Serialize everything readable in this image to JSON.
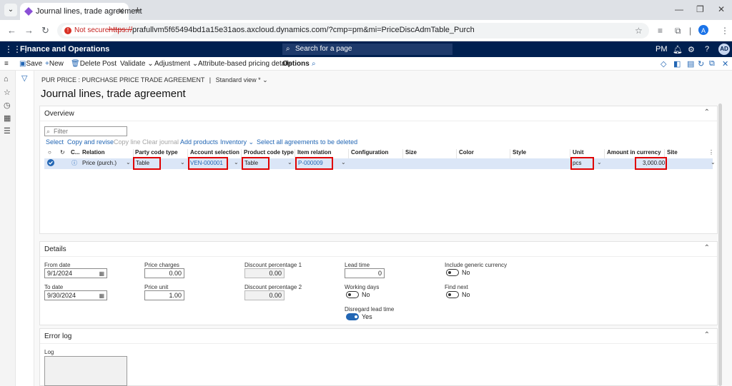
{
  "browser": {
    "tab_title": "Journal lines, trade agreement",
    "not_secure_label": "Not secure",
    "url_protocol": "https://",
    "url_rest": "prafullvm5f65494bd1a15e31aos.axcloud.dynamics.com/?cmp=pm&mi=PriceDiscAdmTable_Purch",
    "profile_initial": "A"
  },
  "navbar": {
    "app_name": "Finance and Operations",
    "search_placeholder": "Search for a page",
    "company": "PM",
    "avatar_initials": "AD"
  },
  "actions": {
    "save": "Save",
    "new": "New",
    "delete": "Delete",
    "post": "Post",
    "validate": "Validate",
    "adjustment": "Adjustment",
    "attribute_pricing": "Attribute-based pricing details",
    "options": "Options"
  },
  "page": {
    "breadcrumb_main": "PUR PRICE : PURCHASE PRICE TRADE AGREEMENT",
    "breadcrumb_sep": "|",
    "view_name": "Standard view *",
    "title": "Journal lines, trade agreement"
  },
  "overview": {
    "header": "Overview",
    "filter_placeholder": "Filter",
    "grid_actions": {
      "select": "Select",
      "copy_revise": "Copy and revise",
      "copy_line": "Copy line",
      "clear_journal": "Clear journal",
      "add_products": "Add products",
      "inventory": "Inventory",
      "select_all_delete": "Select all agreements to be deleted"
    },
    "columns": {
      "c": "C...",
      "relation": "Relation",
      "party_code_type": "Party code type",
      "account_selection": "Account selection",
      "product_code_type": "Product code type",
      "item_relation": "Item relation",
      "configuration": "Configuration",
      "size": "Size",
      "color": "Color",
      "style": "Style",
      "unit": "Unit",
      "amount_in_currency": "Amount in currency",
      "site": "Site"
    },
    "row": {
      "relation": "Price (purch.)",
      "party_code_type": "Table",
      "account_selection": "VEN-000001",
      "product_code_type": "Table",
      "item_relation": "P-000009",
      "unit": "pcs",
      "amount": "3,000.00"
    }
  },
  "details": {
    "header": "Details",
    "from_date_label": "From date",
    "from_date": "9/1/2024",
    "to_date_label": "To date",
    "to_date": "9/30/2024",
    "price_charges_label": "Price charges",
    "price_charges": "0.00",
    "price_unit_label": "Price unit",
    "price_unit": "1.00",
    "disc1_label": "Discount percentage 1",
    "disc1": "0.00",
    "disc2_label": "Discount percentage 2",
    "disc2": "0.00",
    "lead_time_label": "Lead time",
    "lead_time": "0",
    "working_days_label": "Working days",
    "working_days": "No",
    "disregard_lead_label": "Disregard lead time",
    "disregard_lead": "Yes",
    "generic_currency_label": "Include generic currency",
    "generic_currency": "No",
    "find_next_label": "Find next",
    "find_next": "No"
  },
  "errorlog": {
    "header": "Error log",
    "log_label": "Log"
  },
  "colors": {
    "navbar": "#002050",
    "accent": "#2266b4",
    "highlight_box": "#e00000",
    "selected_row": "#dbe6f7"
  }
}
